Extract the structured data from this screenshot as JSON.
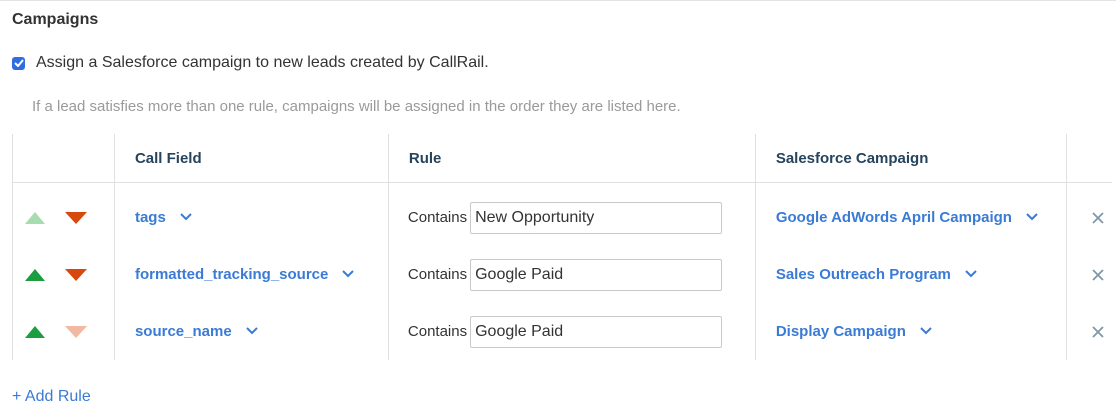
{
  "section": {
    "title": "Campaigns"
  },
  "assign": {
    "checked": true,
    "label": "Assign a Salesforce campaign to new leads created by CallRail."
  },
  "note": "If a lead satisfies more than one rule, campaigns will be assigned in the order they are listed here.",
  "table": {
    "headers": [
      "",
      "Call Field",
      "Rule",
      "Salesforce Campaign",
      ""
    ],
    "rows": [
      {
        "up_enabled": false,
        "down_enabled": true,
        "field": "tags",
        "operator": "Contains",
        "value": "New Opportunity",
        "campaign": "Google AdWords April Campaign"
      },
      {
        "up_enabled": true,
        "down_enabled": true,
        "field": "formatted_tracking_source",
        "operator": "Contains",
        "value": "Google Paid",
        "campaign": "Sales Outreach Program"
      },
      {
        "up_enabled": true,
        "down_enabled": false,
        "field": "source_name",
        "operator": "Contains",
        "value": "Google Paid",
        "campaign": "Display Campaign"
      }
    ]
  },
  "add_rule_label": "+ Add Rule",
  "icons": {
    "move_up": "triangle-up-icon",
    "move_down": "triangle-down-icon",
    "dropdown": "chevron-down-icon",
    "remove": "close-icon",
    "check": "check-icon"
  },
  "colors": {
    "link": "#3a7bd5",
    "header_text": "#27445d",
    "up_arrow": "#1a9e3f",
    "up_arrow_disabled": "#a6dcaf",
    "down_arrow": "#d8470b",
    "down_arrow_disabled": "#f1b9a2",
    "checkbox": "#2f6ee0"
  }
}
